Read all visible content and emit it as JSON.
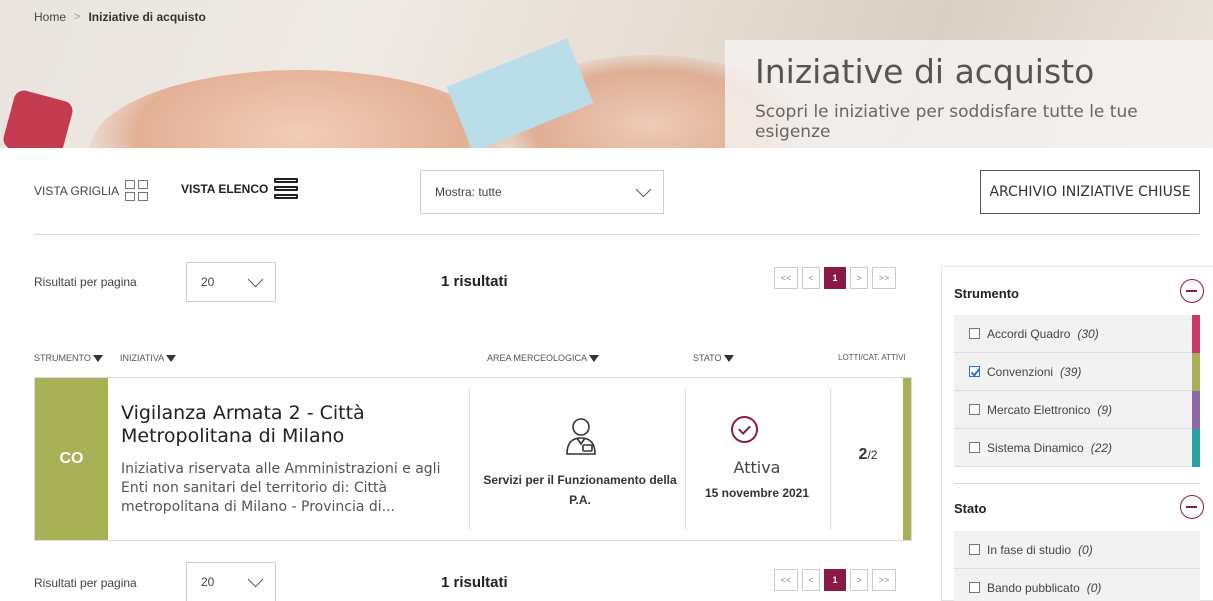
{
  "breadcrumb": {
    "home": "Home",
    "separator": ">",
    "current": "Iniziative di acquisto"
  },
  "hero": {
    "title": "Iniziative di acquisto",
    "subtitle": "Scopri le iniziative per soddisfare tutte le tue esigenze"
  },
  "toolbar": {
    "grid_view": "VISTA GRIGLIA",
    "list_view": "VISTA ELENCO",
    "show_filter": "Mostra: tutte",
    "archive_button": "ARCHIVIO INIZIATIVE CHIUSE"
  },
  "results": {
    "per_page_label": "Risultati per pagina",
    "per_page_value": "20",
    "count_text": "1 risultati",
    "pager": {
      "first": "<<",
      "prev": "<",
      "current": "1",
      "next": ">",
      "last": ">>"
    }
  },
  "table": {
    "headers": {
      "strumento": "STRUMENTO",
      "iniziativa": "INIZIATIVA",
      "area": "AREA MERCEOLOGICA",
      "stato": "STATO",
      "lotti": "LOTTI/CAT. ATTIVI"
    },
    "rows": [
      {
        "badge": "CO",
        "badge_color": "#a8b156",
        "title": "Vigilanza Armata 2 - Città Metropolitana di Milano",
        "description": "Iniziativa riservata alle Amministrazioni e agli Enti non sanitari del territorio di: Città metropolitana di Milano - Provincia di...",
        "area_icon": "person-badge-icon",
        "area": "Servizi per il Funzionamento della P.A.",
        "status": "Attiva",
        "status_date": "15 novembre 2021",
        "lots_active": "2",
        "lots_total": "/2"
      }
    ]
  },
  "sidebar": {
    "strumento": {
      "title": "Strumento",
      "options": [
        {
          "label": "Accordi Quadro",
          "count": "(30)",
          "checked": false,
          "color": "#c8386a"
        },
        {
          "label": "Convenzioni",
          "count": "(39)",
          "checked": true,
          "color": "#a8b156"
        },
        {
          "label": "Mercato Elettronico",
          "count": "(9)",
          "checked": false,
          "color": "#9068a8"
        },
        {
          "label": "Sistema Dinamico",
          "count": "(22)",
          "checked": false,
          "color": "#2aa3a3"
        }
      ]
    },
    "stato": {
      "title": "Stato",
      "options": [
        {
          "label": "In fase di studio",
          "count": "(0)",
          "checked": false
        },
        {
          "label": "Bando pubblicato",
          "count": "(0)",
          "checked": false
        }
      ]
    }
  },
  "colors": {
    "accent": "#8a1a45",
    "convenzioni": "#a8b156"
  }
}
